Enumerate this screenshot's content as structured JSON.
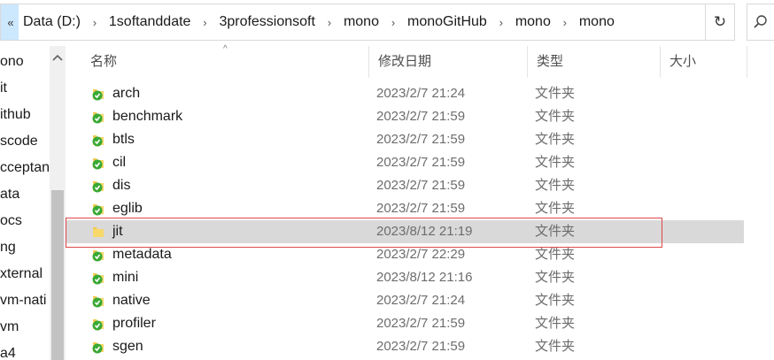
{
  "address": {
    "expand_glyph": "«",
    "crumbs": [
      "Data (D:)",
      "1softanddate",
      "3professionsoft",
      "mono",
      "monoGitHub",
      "mono",
      "mono"
    ],
    "separator": "›",
    "refresh_glyph": "↻"
  },
  "nav": {
    "items": [
      "ono",
      "it",
      "ithub",
      "scode",
      "cceptan",
      "ata",
      "ocs",
      "ng",
      "xternal",
      "vm-nati",
      "vm",
      "a4"
    ]
  },
  "columns": {
    "name": "名称",
    "date": "修改日期",
    "type": "类型",
    "size": "大小"
  },
  "files": [
    {
      "name": "arch",
      "date": "2023/2/7 21:24",
      "type": "文件夹",
      "sync": true
    },
    {
      "name": "benchmark",
      "date": "2023/2/7 21:59",
      "type": "文件夹",
      "sync": true
    },
    {
      "name": "btls",
      "date": "2023/2/7 21:59",
      "type": "文件夹",
      "sync": true
    },
    {
      "name": "cil",
      "date": "2023/2/7 21:59",
      "type": "文件夹",
      "sync": true
    },
    {
      "name": "dis",
      "date": "2023/2/7 21:59",
      "type": "文件夹",
      "sync": true
    },
    {
      "name": "eglib",
      "date": "2023/2/7 21:59",
      "type": "文件夹",
      "sync": true
    },
    {
      "name": "jit",
      "date": "2023/8/12 21:19",
      "type": "文件夹",
      "sync": false,
      "selected": true
    },
    {
      "name": "metadata",
      "date": "2023/2/7 22:29",
      "type": "文件夹",
      "sync": true
    },
    {
      "name": "mini",
      "date": "2023/8/12 21:16",
      "type": "文件夹",
      "sync": true
    },
    {
      "name": "native",
      "date": "2023/2/7 21:24",
      "type": "文件夹",
      "sync": true
    },
    {
      "name": "profiler",
      "date": "2023/2/7 21:59",
      "type": "文件夹",
      "sync": true
    },
    {
      "name": "sgen",
      "date": "2023/2/7 21:59",
      "type": "文件夹",
      "sync": true
    }
  ],
  "colors": {
    "folder": "#f2c94c",
    "sync_badge": "#3aa935",
    "selection": "#d9d9d9",
    "highlight_border": "#e0474c",
    "expand_bg": "#cce8ff"
  }
}
